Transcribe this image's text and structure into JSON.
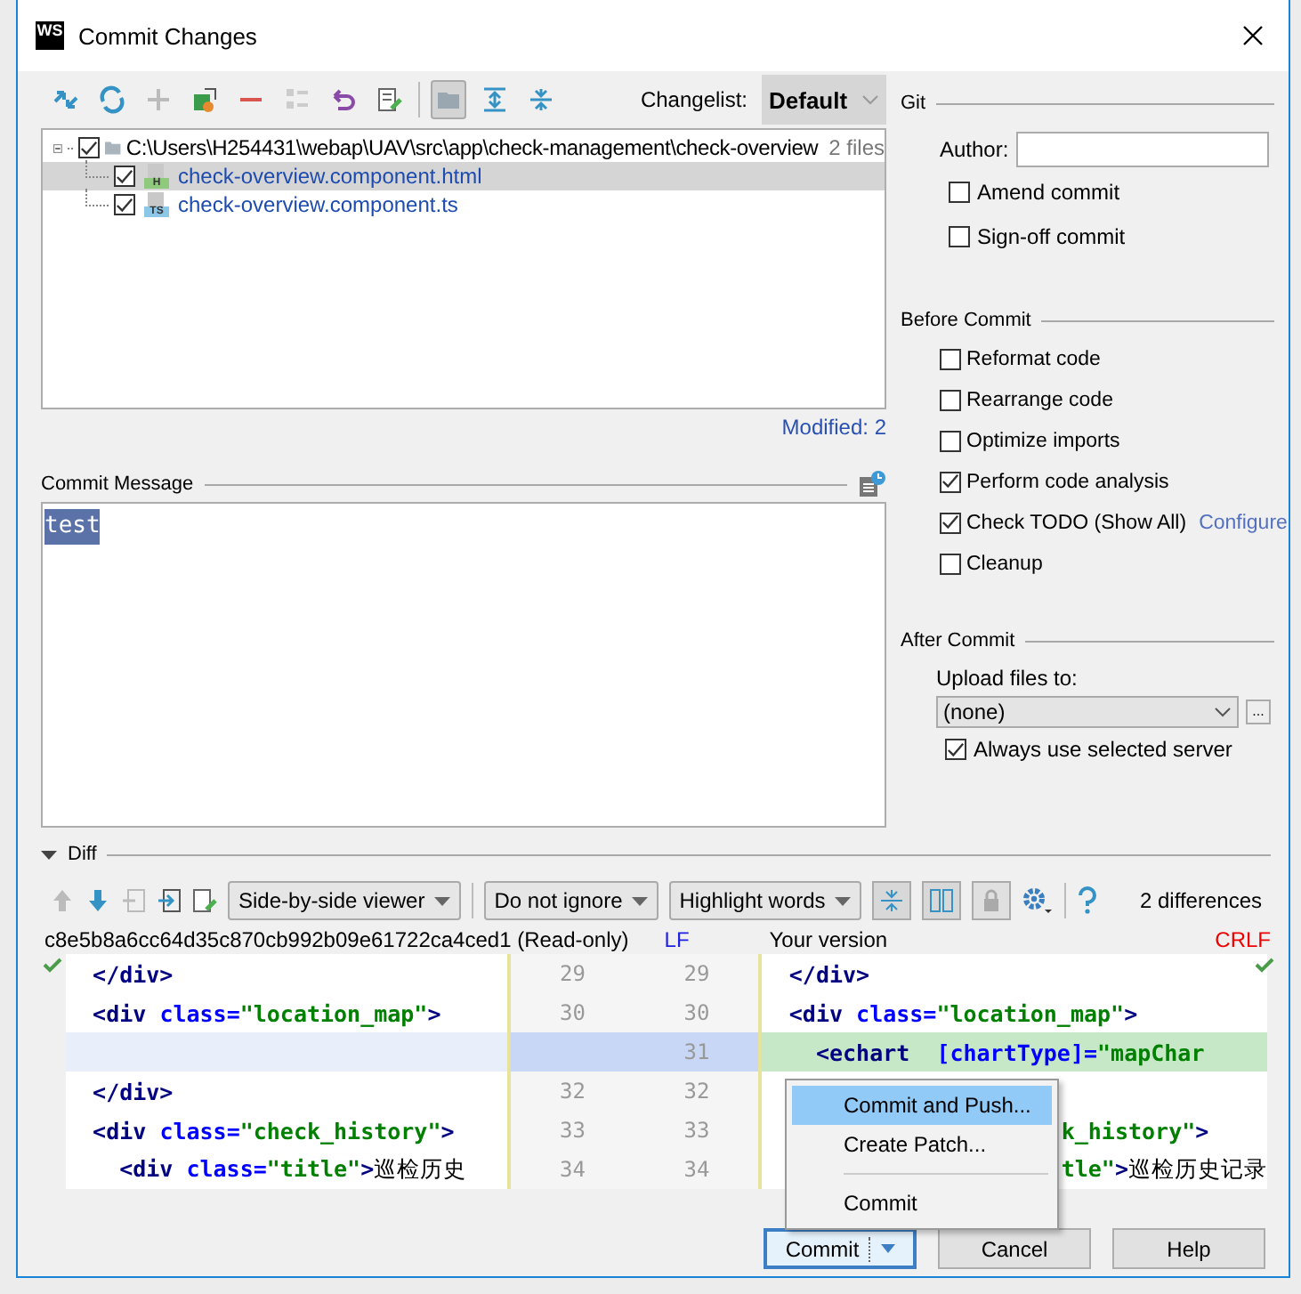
{
  "window": {
    "title": "Commit Changes",
    "logo_text": "WS"
  },
  "toolbar": {
    "icons": [
      {
        "kind": "compare",
        "selected": false
      },
      {
        "kind": "refresh",
        "selected": false
      },
      {
        "kind": "add",
        "selected": false
      },
      {
        "kind": "move",
        "selected": false
      },
      {
        "kind": "remove",
        "selected": false
      },
      {
        "kind": "list",
        "selected": false
      },
      {
        "kind": "revert",
        "selected": false
      },
      {
        "kind": "edit",
        "selected": false
      },
      {
        "kind": "group",
        "selected": true
      },
      {
        "kind": "expand",
        "selected": false
      },
      {
        "kind": "collapse",
        "selected": false
      }
    ],
    "changelist_label": "Changelist:",
    "changelist": "Default"
  },
  "tree": {
    "path": "C:\\Users\\H254431\\webap\\UAV\\src\\app\\check-management\\check-overview",
    "count": "2 files",
    "checked": true,
    "expanded": true,
    "children": [
      {
        "name": "check-overview.component.html",
        "badge": "H",
        "checked": true,
        "selected": true
      },
      {
        "name": "check-overview.component.ts",
        "badge": "TS",
        "checked": true,
        "selected": false
      }
    ]
  },
  "modified": "Modified: 2",
  "commit_message": {
    "label": "Commit Message",
    "value": "test"
  },
  "git": {
    "title": "Git",
    "author_label": "Author:",
    "options": [
      {
        "label": "Amend commit",
        "checked": false
      },
      {
        "label": "Sign-off commit",
        "checked": false
      }
    ]
  },
  "before_commit": {
    "title": "Before Commit",
    "options": [
      {
        "label": "Reformat code",
        "checked": false
      },
      {
        "label": "Rearrange code",
        "checked": false
      },
      {
        "label": "Optimize imports",
        "checked": false
      },
      {
        "label": "Perform code analysis",
        "checked": true
      },
      {
        "label": "Check TODO (Show All)",
        "checked": true,
        "link": "Configure"
      },
      {
        "label": "Cleanup",
        "checked": false
      }
    ]
  },
  "after_commit": {
    "title": "After Commit",
    "upload_label": "Upload files to:",
    "server": "(none)",
    "more": "...",
    "always": {
      "label": "Always use selected server",
      "checked": true
    }
  },
  "diff": {
    "title": "Diff",
    "expanded": true,
    "viewer": "Side-by-side viewer",
    "ignore": "Do not ignore",
    "highlight": "Highlight words",
    "count": "2 differences",
    "left_title": "c8e5b8a6cc64d35c870cb992b09e61722ca4ced1 (Read-only)",
    "left_sep": "LF",
    "right_title": "Your version",
    "right_sep": "CRLF",
    "rows": [
      {
        "kind": "context",
        "left_no": "29",
        "right_no": "29",
        "left": [
          {
            "text": "  </div>",
            "kind": "tag"
          }
        ],
        "right": [
          {
            "text": "  </div>",
            "kind": "tag"
          }
        ]
      },
      {
        "kind": "context",
        "left_no": "30",
        "right_no": "30",
        "left": [
          {
            "text": "  <div ",
            "kind": "tag"
          },
          {
            "text": "class=",
            "kind": "attr"
          },
          {
            "text": "\"location_map\"",
            "kind": "str"
          },
          {
            "text": ">",
            "kind": "tag"
          }
        ],
        "right": [
          {
            "text": "  <div ",
            "kind": "tag"
          },
          {
            "text": "class=",
            "kind": "attr"
          },
          {
            "text": "\"location_map\"",
            "kind": "str"
          },
          {
            "text": ">",
            "kind": "tag"
          }
        ]
      },
      {
        "kind": "inserted",
        "right_no": "31",
        "right": [
          {
            "text": "    <echart  ",
            "kind": "tag"
          },
          {
            "text": "[chartType]=",
            "kind": "attr"
          },
          {
            "text": "\"mapChar",
            "kind": "str"
          }
        ]
      },
      {
        "kind": "context",
        "left_no": "32",
        "right_no": "32",
        "left": [
          {
            "text": "  </div>",
            "kind": "tag"
          }
        ]
      },
      {
        "kind": "context",
        "left_no": "33",
        "right_no": "33",
        "left": [
          {
            "text": "  <div ",
            "kind": "tag"
          },
          {
            "text": "class=",
            "kind": "attr"
          },
          {
            "text": "\"check_history\"",
            "kind": "str"
          },
          {
            "text": ">",
            "kind": "tag"
          }
        ],
        "right": [
          {
            "text": "k_history\"",
            "kind": "str"
          },
          {
            "text": ">",
            "kind": "tag"
          }
        ],
        "right_partial": true
      },
      {
        "kind": "context",
        "left_no": "34",
        "right_no": "34",
        "left": [
          {
            "text": "    <div ",
            "kind": "tag"
          },
          {
            "text": "class=",
            "kind": "attr"
          },
          {
            "text": "\"title\"",
            "kind": "str"
          },
          {
            "text": ">",
            "kind": "tag"
          },
          {
            "text": "巡检历史",
            "kind": "text"
          }
        ],
        "right": [
          {
            "text": "tle\"",
            "kind": "str"
          },
          {
            "text": ">",
            "kind": "tag"
          },
          {
            "text": "巡检历史记录",
            "kind": "text"
          }
        ],
        "right_partial": true
      }
    ]
  },
  "popup": {
    "items": [
      {
        "kind": "item",
        "label": "Commit and Push...",
        "selected": true
      },
      {
        "kind": "item",
        "label": "Create Patch...",
        "selected": false
      },
      {
        "kind": "separator"
      },
      {
        "kind": "item",
        "label": "Commit",
        "selected": false
      }
    ]
  },
  "buttons": [
    {
      "kind": "split",
      "label": "Commit"
    },
    {
      "kind": "plain",
      "label": "Cancel"
    },
    {
      "kind": "plain",
      "label": "Help"
    }
  ]
}
